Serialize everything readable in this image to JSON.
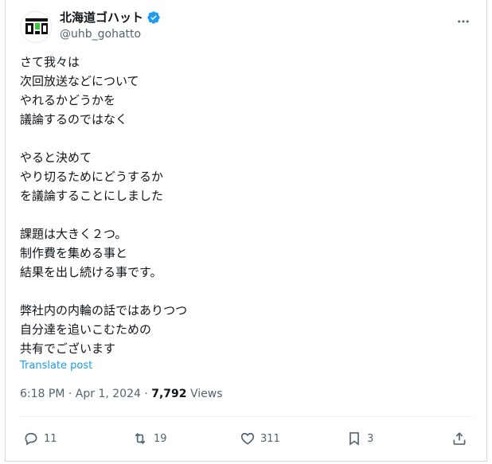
{
  "author": {
    "display_name": "北海道ゴハット",
    "handle": "@uhb_gohatto",
    "verified_icon": "verified-badge-icon",
    "avatar_logo_text": "北海道ゴハット"
  },
  "post": {
    "text": "さて我々は\n次回放送などについて\nやれるかどうかを\n議論するのではなく\n\nやると決めて\nやり切るためにどうするか\nを議論することにしました\n\n課題は大きく２つ。\n制作費を集める事と\n結果を出し続ける事です。\n\n弊社内の内輪の話ではありつつ\n自分達を追いこむための\n共有でございます",
    "translate_label": "Translate post",
    "time": "6:18 PM",
    "separator": "·",
    "date": "Apr 1, 2024",
    "views_count": "7,792",
    "views_label": "Views"
  },
  "actions": {
    "reply_count": "11",
    "repost_count": "19",
    "like_count": "311",
    "bookmark_count": "3"
  },
  "colors": {
    "accent": "#1d9bf0",
    "secondary_text": "#536471",
    "primary_text": "#0f1419",
    "border": "#cfd9de"
  }
}
